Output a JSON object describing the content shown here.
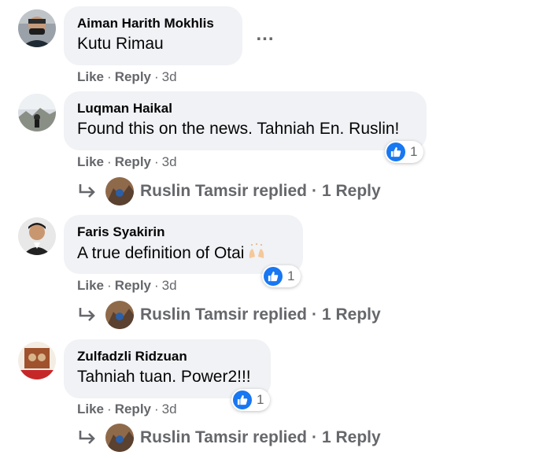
{
  "comments": [
    {
      "author": "Aiman Harith Mokhlis",
      "text": "Kutu Rimau",
      "like_label": "Like",
      "reply_label": "Reply",
      "time": "3d",
      "more_label": "..."
    },
    {
      "author": "Luqman Haikal",
      "text": "Found this on the news. Tahniah En. Ruslin!",
      "like_label": "Like",
      "reply_label": "Reply",
      "time": "3d",
      "reaction_count": "1",
      "reply_author_text": "Ruslin Tamsir replied",
      "reply_count_text": "1 Reply"
    },
    {
      "author": "Faris Syakirin",
      "text": "A true definition of Otai",
      "like_label": "Like",
      "reply_label": "Reply",
      "time": "3d",
      "reaction_count": "1",
      "reply_author_text": "Ruslin Tamsir replied",
      "reply_count_text": "1 Reply"
    },
    {
      "author": "Zulfadzli Ridzuan",
      "text": "Tahniah tuan. Power2!!!",
      "like_label": "Like",
      "reply_label": "Reply",
      "time": "3d",
      "reaction_count": "1",
      "reply_author_text": "Ruslin Tamsir replied",
      "reply_count_text": "1 Reply"
    }
  ],
  "separators": {
    "dot": "·"
  },
  "colors": {
    "bubble": "#f0f2f5",
    "meta_text": "#65676b",
    "like_blue": "#1877f2"
  },
  "icons": {
    "like": "like-thumb-icon",
    "reply": "reply-arrow-icon",
    "more": "more-options-icon",
    "emoji": "raised-hands-emoji-icon"
  }
}
